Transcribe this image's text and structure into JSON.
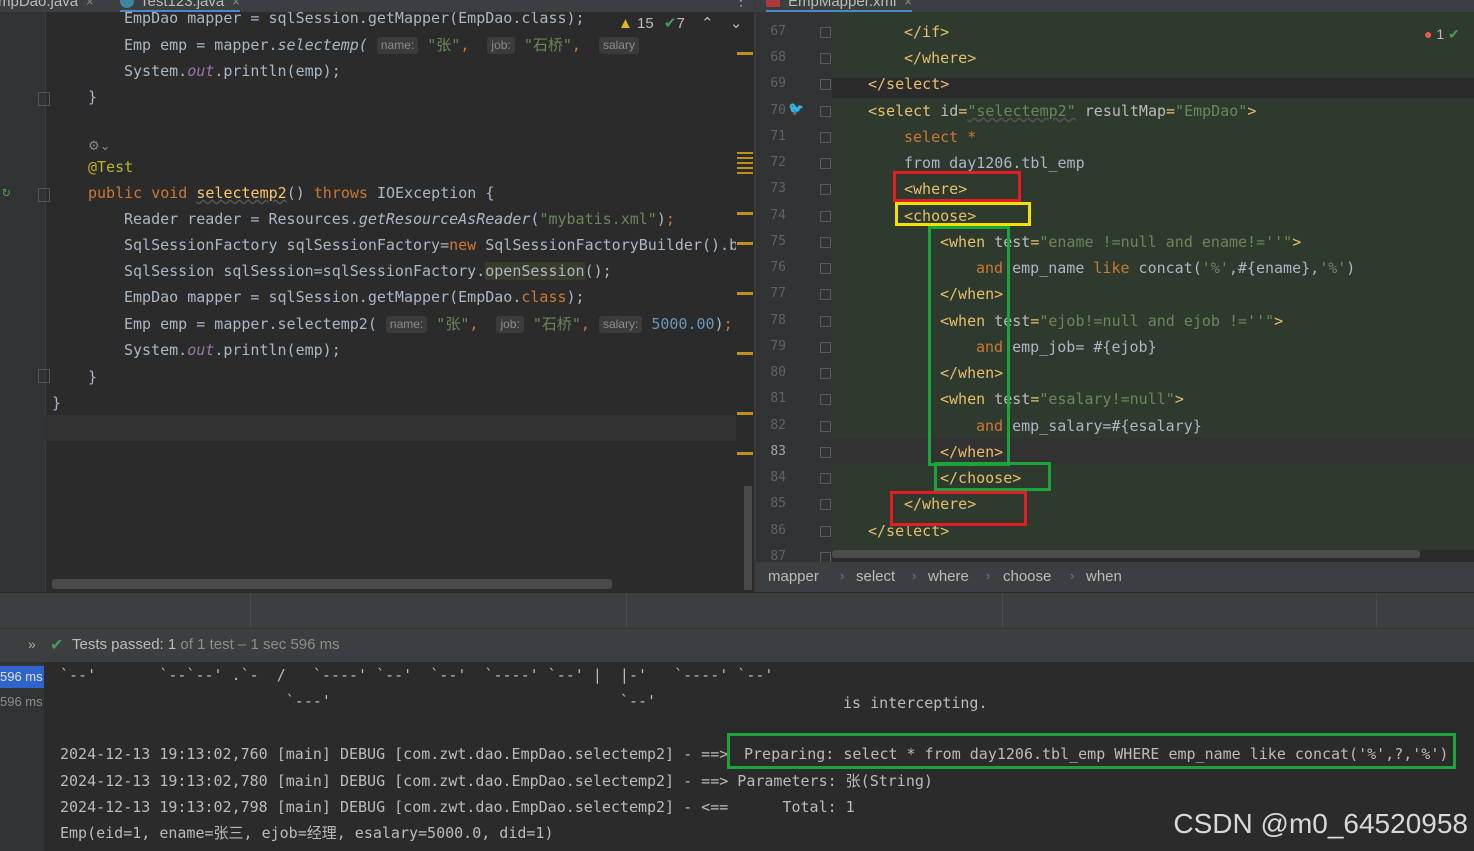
{
  "tabs": {
    "left": [
      {
        "label": "mpDao.java"
      },
      {
        "label": "Test123.java"
      }
    ],
    "right": [
      {
        "label": "EmpMapper.xml"
      }
    ]
  },
  "inspections": {
    "warnings": "15",
    "checks": "7"
  },
  "right_errors": "1",
  "java": {
    "top_partial": "EmpDao mapper = sqlSession.getMapper(EmpDao.class);",
    "line_emp1_pre": "Emp emp = mapper.",
    "line_emp1_fn": "selectemp(",
    "hint_name": "name:",
    "val_name": "\"张\"",
    "hint_job": "job:",
    "val_job": "\"石桥\"",
    "hint_salary": "salary:",
    "hint_salary_short": "salary",
    "val_salary": "5000.00",
    "println_pre": "System.",
    "println_out": "out",
    "println_post": ".println(emp);",
    "close_brace": "}",
    "annotation": "@Test",
    "method_public": "public",
    "method_void": "void",
    "method_name": "selectemp2",
    "method_paren": "() ",
    "method_throws": "throws",
    "method_exc": " IOException {",
    "reader_pre": "Reader reader = Resources.",
    "reader_fn": "getResourceAsReader",
    "reader_str": "\"mybatis.xml\"",
    "factory_pre": "SqlSessionFactory sqlSessionFactory=",
    "factory_new": "new",
    "factory_post": " SqlSessionFactoryBuilder().bui",
    "session_pre": "SqlSession sqlSession=sqlSessionFactory.",
    "session_fn": "openSession",
    "session_post": "();",
    "mapper_pre": "EmpDao mapper = sqlSession.getMapper(EmpDao.",
    "mapper_class": "class",
    "mapper_post": ");",
    "line_emp2_pre": "Emp emp = mapper.",
    "line_emp2_fn": "selectemp2(",
    "outer_brace": "}"
  },
  "xml": {
    "lines": [
      {
        "n": "67",
        "text": "</if>"
      },
      {
        "n": "68",
        "text": "</where>"
      },
      {
        "n": "69",
        "text": "</select>"
      },
      {
        "n": "70",
        "text": ""
      },
      {
        "n": "71",
        "text": "select *"
      },
      {
        "n": "72",
        "text": "from day1206.tbl_emp"
      },
      {
        "n": "73",
        "text": "<where>"
      },
      {
        "n": "74",
        "text": "<choose>"
      },
      {
        "n": "75",
        "text": ""
      },
      {
        "n": "76",
        "text": ""
      },
      {
        "n": "77",
        "text": "</when>"
      },
      {
        "n": "78",
        "text": ""
      },
      {
        "n": "79",
        "text": ""
      },
      {
        "n": "80",
        "text": "</when>"
      },
      {
        "n": "81",
        "text": ""
      },
      {
        "n": "82",
        "text": ""
      },
      {
        "n": "83",
        "text": "</when>"
      },
      {
        "n": "84",
        "text": "</choose>"
      },
      {
        "n": "85",
        "text": "</where>"
      },
      {
        "n": "86",
        "text": "</select>"
      },
      {
        "n": "87",
        "text": ""
      }
    ],
    "select_open": "<select ",
    "select_id_attr": "id",
    "select_id_val": "\"selectemp2\"",
    "select_rm_attr": " resultMap",
    "select_rm_val": "\"EmpDao\"",
    "when1_attr_val": "\"ename !=null and ename!=''\"",
    "when1_body_and": "and",
    "when1_body_rest": " emp_name ",
    "when1_like": "like",
    "when1_concat": " concat(",
    "when1_pct1": "'%'",
    "when1_mid": ",#{ename},",
    "when1_pct2": "'%'",
    "when1_close": ")",
    "when2_attr_val": "\"ejob!=null and ejob !=''\"",
    "when2_body_and": "and",
    "when2_body_rest": " emp_job= #{ejob}",
    "when3_attr_val": "\"esalary!=null\"",
    "when3_body_and": "and",
    "when3_body_rest": " emp_salary=#{esalary}",
    "when_open": "<when ",
    "when_test": "test",
    "when_gt": ">",
    "eq": "="
  },
  "breadcrumb": [
    "mapper",
    "select",
    "where",
    "choose",
    "when"
  ],
  "run": {
    "tests_passed_label": "Tests passed:",
    "tests_passed_count": "1",
    "tests_passed_detail": "of 1 test – 1 sec 596 ms",
    "times": [
      "596 ms",
      "596 ms"
    ]
  },
  "console": {
    "art1": "`--'       `--`--' .`-  /   `----' `--'  `--'  `----' `--' |  |-'   `----' `--'",
    "art2": "                         `---'                                `--'",
    "intercept": "is intercepting.",
    "log1_prefix": "2024-12-13 19:13:02,760 [main] DEBUG [com.zwt.dao.EmpDao.selectemp2] - ==>",
    "log1_msg": "Preparing: select * from day1206.tbl_emp WHERE emp_name like concat('%',?,'%')",
    "log2": "2024-12-13 19:13:02,780 [main] DEBUG [com.zwt.dao.EmpDao.selectemp2] - ==> Parameters: 张(String)",
    "log3": "2024-12-13 19:13:02,798 [main] DEBUG [com.zwt.dao.EmpDao.selectemp2] - <==      Total: 1",
    "result": "Emp(eid=1, ename=张三, ejob=经理, esalary=5000.0, did=1)"
  },
  "watermark": "CSDN @m0_64520958",
  "colors": {
    "annotation_red": "#e51c23",
    "annotation_yellow": "#f5e100",
    "annotation_green": "#1aa43a"
  }
}
